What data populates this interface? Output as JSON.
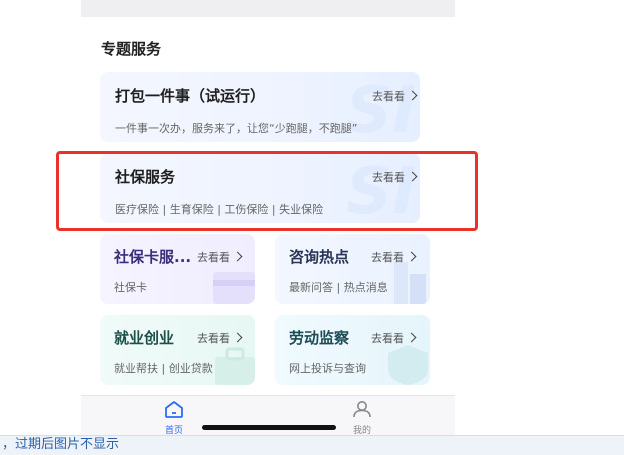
{
  "section_title": "专题服务",
  "cards": {
    "bundle": {
      "title": "打包一件事（试运行）",
      "more": "去看看",
      "sub": "一件事一次办，服务来了，让您“少跑腿，不跑腿”"
    },
    "social": {
      "title": "社保服务",
      "more": "去看看",
      "sub": "医疗保险 | 生育保险 | 工伤保险 | 失业保险"
    },
    "card": {
      "title": "社保卡服...",
      "more": "去看看",
      "sub": "社保卡"
    },
    "hotspot": {
      "title": "咨询热点",
      "more": "去看看",
      "sub": "最新问答 | 热点消息"
    },
    "employment": {
      "title": "就业创业",
      "more": "去看看",
      "sub": "就业帮扶 | 创业贷款"
    },
    "labor": {
      "title": "劳动监察",
      "more": "去看看",
      "sub": "网上投诉与查询"
    }
  },
  "tabbar": {
    "home_label": "首页",
    "mine_label": "我的"
  },
  "bottom_text": "，过期后图片不显示",
  "colors": {
    "accent": "#2a6cf0",
    "highlight_border": "#e8322a",
    "tab_active": "#2a6cf0",
    "tab_inactive": "#888888"
  },
  "icons": {
    "home": "home-icon",
    "mine": "user-icon",
    "more": "chevron-right-icon"
  }
}
